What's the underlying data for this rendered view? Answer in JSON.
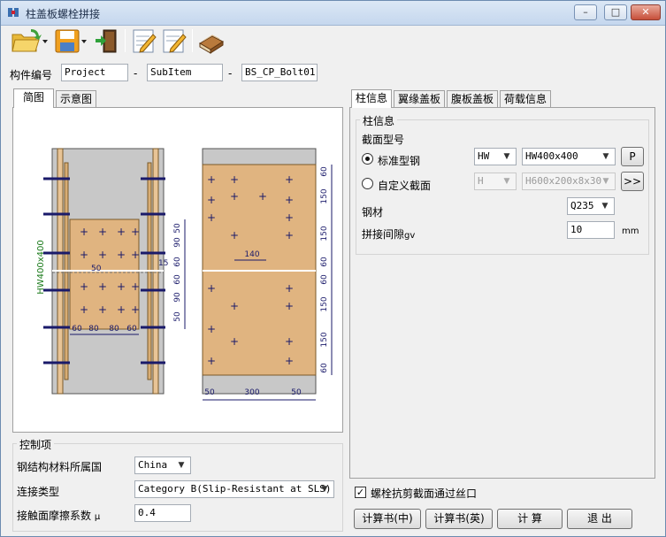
{
  "window": {
    "title": "柱盖板螺栓拼接"
  },
  "member_id": {
    "label": "构件编号",
    "project": "Project",
    "subitem": "SubItem",
    "name": "BS_CP_Bolt01",
    "sep": "-"
  },
  "view_tabs": [
    "简图",
    "示意图"
  ],
  "drawing": {
    "section_label": "HW400x400",
    "left_dims": [
      "60",
      "80",
      "80",
      "60"
    ],
    "left_vertical_dims": [
      "50",
      "90",
      "60",
      "60",
      "90",
      "50"
    ],
    "left_side_dim": "15",
    "left_small": "50",
    "right_dims": [
      "50",
      "300",
      "50"
    ],
    "right_inner_dim": "140",
    "right_vertical_dims": [
      "60",
      "150",
      "150",
      "60",
      "60",
      "150",
      "150",
      "60"
    ]
  },
  "right_tabs": [
    "柱信息",
    "翼缘盖板",
    "腹板盖板",
    "荷载信息"
  ],
  "column_info": {
    "group_title": "柱信息",
    "section_type_label": "截面型号",
    "standard_label": "标准型钢",
    "custom_label": "自定义截面",
    "std_type": "HW",
    "std_size": "HW400x400",
    "std_button": "P",
    "custom_type": "H",
    "custom_size": "H600x200x8x30",
    "custom_button": ">>",
    "steel_label": "钢材",
    "steel_value": "Q235",
    "gap_label": "拼接间隙",
    "gap_sub": "gv",
    "gap_value": "10",
    "gap_unit": "mm"
  },
  "controls": {
    "group_title": "控制项",
    "country_label": "钢结构材料所属国",
    "country_value": "China",
    "conn_label": "连接类型",
    "conn_value": "Category B(Slip-Resistant at SLS)",
    "mu_label": "接触面摩擦系数",
    "mu_symbol": "μ",
    "mu_value": "0.4"
  },
  "shear_check": {
    "label": "螺栓抗剪截面通过丝口",
    "checked": "✓"
  },
  "buttons": {
    "report_cn": "计算书(中)",
    "report_en": "计算书(英)",
    "calc": "计  算",
    "exit": "退  出"
  }
}
